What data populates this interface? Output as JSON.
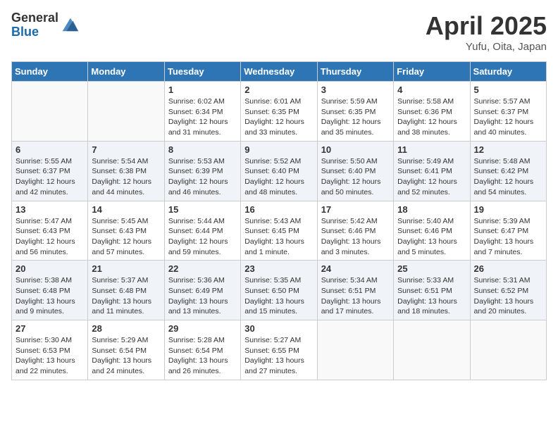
{
  "header": {
    "logo_general": "General",
    "logo_blue": "Blue",
    "month_title": "April 2025",
    "location": "Yufu, Oita, Japan"
  },
  "weekdays": [
    "Sunday",
    "Monday",
    "Tuesday",
    "Wednesday",
    "Thursday",
    "Friday",
    "Saturday"
  ],
  "weeks": [
    [
      {
        "day": "",
        "sunrise": "",
        "sunset": "",
        "daylight": ""
      },
      {
        "day": "",
        "sunrise": "",
        "sunset": "",
        "daylight": ""
      },
      {
        "day": "1",
        "sunrise": "Sunrise: 6:02 AM",
        "sunset": "Sunset: 6:34 PM",
        "daylight": "Daylight: 12 hours and 31 minutes."
      },
      {
        "day": "2",
        "sunrise": "Sunrise: 6:01 AM",
        "sunset": "Sunset: 6:35 PM",
        "daylight": "Daylight: 12 hours and 33 minutes."
      },
      {
        "day": "3",
        "sunrise": "Sunrise: 5:59 AM",
        "sunset": "Sunset: 6:35 PM",
        "daylight": "Daylight: 12 hours and 35 minutes."
      },
      {
        "day": "4",
        "sunrise": "Sunrise: 5:58 AM",
        "sunset": "Sunset: 6:36 PM",
        "daylight": "Daylight: 12 hours and 38 minutes."
      },
      {
        "day": "5",
        "sunrise": "Sunrise: 5:57 AM",
        "sunset": "Sunset: 6:37 PM",
        "daylight": "Daylight: 12 hours and 40 minutes."
      }
    ],
    [
      {
        "day": "6",
        "sunrise": "Sunrise: 5:55 AM",
        "sunset": "Sunset: 6:37 PM",
        "daylight": "Daylight: 12 hours and 42 minutes."
      },
      {
        "day": "7",
        "sunrise": "Sunrise: 5:54 AM",
        "sunset": "Sunset: 6:38 PM",
        "daylight": "Daylight: 12 hours and 44 minutes."
      },
      {
        "day": "8",
        "sunrise": "Sunrise: 5:53 AM",
        "sunset": "Sunset: 6:39 PM",
        "daylight": "Daylight: 12 hours and 46 minutes."
      },
      {
        "day": "9",
        "sunrise": "Sunrise: 5:52 AM",
        "sunset": "Sunset: 6:40 PM",
        "daylight": "Daylight: 12 hours and 48 minutes."
      },
      {
        "day": "10",
        "sunrise": "Sunrise: 5:50 AM",
        "sunset": "Sunset: 6:40 PM",
        "daylight": "Daylight: 12 hours and 50 minutes."
      },
      {
        "day": "11",
        "sunrise": "Sunrise: 5:49 AM",
        "sunset": "Sunset: 6:41 PM",
        "daylight": "Daylight: 12 hours and 52 minutes."
      },
      {
        "day": "12",
        "sunrise": "Sunrise: 5:48 AM",
        "sunset": "Sunset: 6:42 PM",
        "daylight": "Daylight: 12 hours and 54 minutes."
      }
    ],
    [
      {
        "day": "13",
        "sunrise": "Sunrise: 5:47 AM",
        "sunset": "Sunset: 6:43 PM",
        "daylight": "Daylight: 12 hours and 56 minutes."
      },
      {
        "day": "14",
        "sunrise": "Sunrise: 5:45 AM",
        "sunset": "Sunset: 6:43 PM",
        "daylight": "Daylight: 12 hours and 57 minutes."
      },
      {
        "day": "15",
        "sunrise": "Sunrise: 5:44 AM",
        "sunset": "Sunset: 6:44 PM",
        "daylight": "Daylight: 12 hours and 59 minutes."
      },
      {
        "day": "16",
        "sunrise": "Sunrise: 5:43 AM",
        "sunset": "Sunset: 6:45 PM",
        "daylight": "Daylight: 13 hours and 1 minute."
      },
      {
        "day": "17",
        "sunrise": "Sunrise: 5:42 AM",
        "sunset": "Sunset: 6:46 PM",
        "daylight": "Daylight: 13 hours and 3 minutes."
      },
      {
        "day": "18",
        "sunrise": "Sunrise: 5:40 AM",
        "sunset": "Sunset: 6:46 PM",
        "daylight": "Daylight: 13 hours and 5 minutes."
      },
      {
        "day": "19",
        "sunrise": "Sunrise: 5:39 AM",
        "sunset": "Sunset: 6:47 PM",
        "daylight": "Daylight: 13 hours and 7 minutes."
      }
    ],
    [
      {
        "day": "20",
        "sunrise": "Sunrise: 5:38 AM",
        "sunset": "Sunset: 6:48 PM",
        "daylight": "Daylight: 13 hours and 9 minutes."
      },
      {
        "day": "21",
        "sunrise": "Sunrise: 5:37 AM",
        "sunset": "Sunset: 6:48 PM",
        "daylight": "Daylight: 13 hours and 11 minutes."
      },
      {
        "day": "22",
        "sunrise": "Sunrise: 5:36 AM",
        "sunset": "Sunset: 6:49 PM",
        "daylight": "Daylight: 13 hours and 13 minutes."
      },
      {
        "day": "23",
        "sunrise": "Sunrise: 5:35 AM",
        "sunset": "Sunset: 6:50 PM",
        "daylight": "Daylight: 13 hours and 15 minutes."
      },
      {
        "day": "24",
        "sunrise": "Sunrise: 5:34 AM",
        "sunset": "Sunset: 6:51 PM",
        "daylight": "Daylight: 13 hours and 17 minutes."
      },
      {
        "day": "25",
        "sunrise": "Sunrise: 5:33 AM",
        "sunset": "Sunset: 6:51 PM",
        "daylight": "Daylight: 13 hours and 18 minutes."
      },
      {
        "day": "26",
        "sunrise": "Sunrise: 5:31 AM",
        "sunset": "Sunset: 6:52 PM",
        "daylight": "Daylight: 13 hours and 20 minutes."
      }
    ],
    [
      {
        "day": "27",
        "sunrise": "Sunrise: 5:30 AM",
        "sunset": "Sunset: 6:53 PM",
        "daylight": "Daylight: 13 hours and 22 minutes."
      },
      {
        "day": "28",
        "sunrise": "Sunrise: 5:29 AM",
        "sunset": "Sunset: 6:54 PM",
        "daylight": "Daylight: 13 hours and 24 minutes."
      },
      {
        "day": "29",
        "sunrise": "Sunrise: 5:28 AM",
        "sunset": "Sunset: 6:54 PM",
        "daylight": "Daylight: 13 hours and 26 minutes."
      },
      {
        "day": "30",
        "sunrise": "Sunrise: 5:27 AM",
        "sunset": "Sunset: 6:55 PM",
        "daylight": "Daylight: 13 hours and 27 minutes."
      },
      {
        "day": "",
        "sunrise": "",
        "sunset": "",
        "daylight": ""
      },
      {
        "day": "",
        "sunrise": "",
        "sunset": "",
        "daylight": ""
      },
      {
        "day": "",
        "sunrise": "",
        "sunset": "",
        "daylight": ""
      }
    ]
  ]
}
